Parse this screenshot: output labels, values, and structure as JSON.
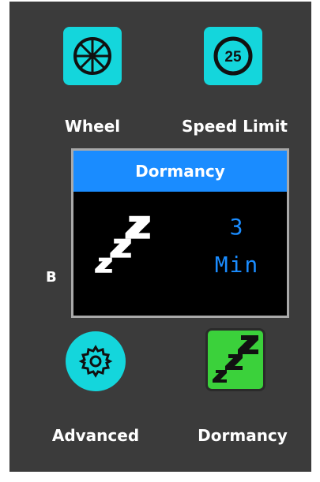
{
  "menu": {
    "items": [
      {
        "label": "Wheel",
        "icon": "wheel-icon"
      },
      {
        "label": "Speed Limit",
        "icon": "speed-limit-icon",
        "badge": "25"
      },
      {
        "label": "Advanced",
        "icon": "gear-icon"
      },
      {
        "label": "Dormancy",
        "icon": "sleep-zzz-icon"
      }
    ],
    "partial_label": "B"
  },
  "dialog": {
    "title": "Dormancy",
    "icon": "sleep-zzz-icon",
    "value": "3",
    "unit": "Min"
  },
  "colors": {
    "background": "#3b3b3b",
    "tile_cyan": "#14d6dc",
    "tile_green": "#3bd13b",
    "dialog_header": "#1a8cff",
    "dialog_text": "#1a8cff"
  }
}
